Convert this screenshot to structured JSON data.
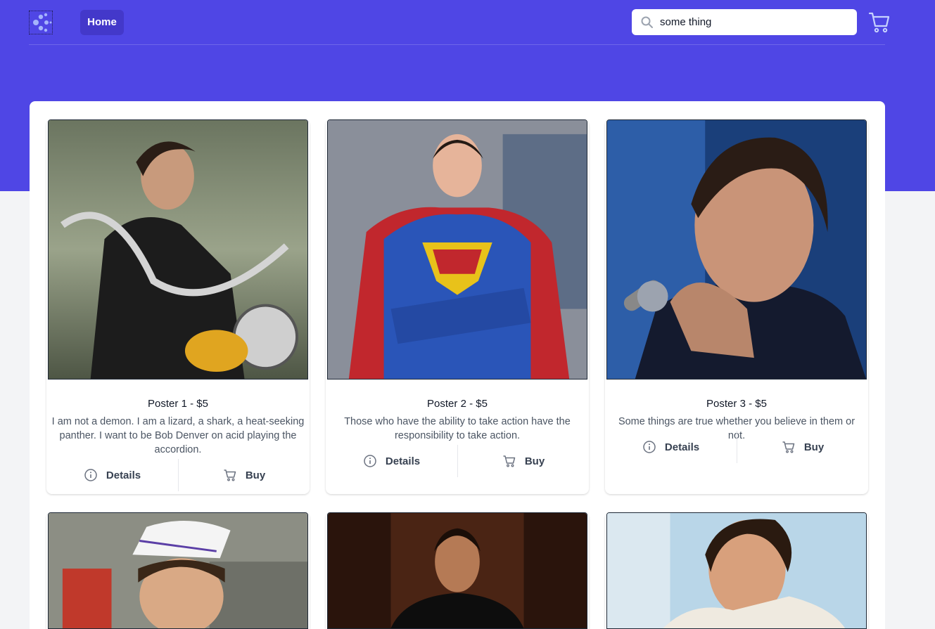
{
  "colors": {
    "brand": "#4f46e5",
    "brand_dark": "#4338ca",
    "background": "#f3f4f6"
  },
  "nav": {
    "logo_icon": "dots-logo-icon",
    "home_label": "Home",
    "search_value": "some thing",
    "search_icon": "search-icon",
    "cart_icon": "cart-icon"
  },
  "products": [
    {
      "title": "Poster 1 - $5",
      "description": "I am not a demon. I am a lizard, a shark, a heat-seeking panther. I want to be Bob Denver on acid playing the accordion.",
      "details_label": "Details",
      "buy_label": "Buy"
    },
    {
      "title": "Poster 2 - $5",
      "description": "Those who have the ability to take action have the responsibility to take action.",
      "details_label": "Details",
      "buy_label": "Buy"
    },
    {
      "title": "Poster 3 - $5",
      "description": "Some things are true whether you believe in them or not.",
      "details_label": "Details",
      "buy_label": "Buy"
    }
  ]
}
